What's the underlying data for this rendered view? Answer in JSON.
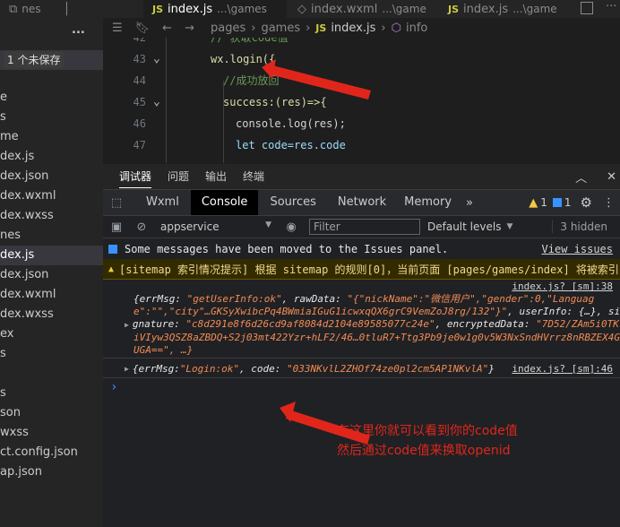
{
  "tabs": [
    {
      "name": "nes",
      "js": false,
      "path": ""
    },
    {
      "name": "index.js",
      "js": true,
      "path": "...\\games",
      "active": true
    },
    {
      "name": "index.wxml",
      "js": false,
      "path": "...\\game"
    },
    {
      "name": "index.js",
      "js": true,
      "path": "...\\game"
    }
  ],
  "tab_js_label": "JS",
  "explorer": {
    "more": "...",
    "unsaved": "1 个未保存",
    "items": [
      "e",
      "s",
      "me",
      "dex.js",
      "dex.json",
      "dex.wxml",
      "dex.wxss",
      "nes",
      "dex.js",
      "dex.json",
      "dex.wxml",
      "dex.wxss",
      "ex",
      "s",
      "",
      "s",
      "son",
      "wxss",
      "ct.config.json",
      "ap.json"
    ],
    "selected_index": 8
  },
  "breadcrumb": {
    "items": [
      "pages",
      "games",
      "index.js",
      "info"
    ],
    "js_label": "JS"
  },
  "code": {
    "lines": [
      {
        "no": "42",
        "text": "// 获取code值"
      },
      {
        "no": "43",
        "text": "wx.login({"
      },
      {
        "no": "44",
        "text": "//成功放回"
      },
      {
        "no": "45",
        "text": "success:(res)=>{"
      },
      {
        "no": "46",
        "text": "console.log(res);"
      },
      {
        "no": "47",
        "text": "let code=res.code"
      }
    ]
  },
  "devtools": {
    "top_tabs": [
      "调试器",
      "问题",
      "输出",
      "终端"
    ],
    "panel_tabs": [
      "Wxml",
      "Console",
      "Sources",
      "Network",
      "Memory"
    ],
    "more": "»",
    "warn_count": "1",
    "info_count": "1",
    "context": "appservice",
    "filter_placeholder": "Filter",
    "levels": "Default levels",
    "hidden": "3 hidden"
  },
  "console": {
    "info_msg": "Some messages have been moved to the Issues panel.",
    "info_link": "View issues",
    "warn_msg": "[sitemap 索引情况提示] 根据 sitemap 的规则[0]，当前页面 [pages/games/index] 将被索引",
    "log1_src": "index.js? [sm]:38",
    "log1_l1a": "{errMsg: ",
    "log1_l1b": "\"getUserInfo:ok\"",
    "log1_l1c": ", rawData: ",
    "log1_l1d": "\"{\"nickName\":\"微信用户\",\"gender\":0,\"Languag",
    "log1_l2a": "e\":\"\",\"city\"…GKSyXwibcPq4BWmiaIGuG1icwxqQX6grC9VemZoJ8rg/132\"}\"",
    "log1_l2b": ", userInfo: {…}, si",
    "log1_l3a": "gnature: ",
    "log1_l3b": "\"c8d291e8f6d26cd9af8084d2104e89585077c24e\"",
    "log1_l3c": ", encryptedData: ",
    "log1_l3d": "\"7D52/ZAm5i0TK",
    "log1_l4": "iVIyw3QSZ8aZBDQ+S2j03mt422Yzr+hLF2/46…0tluR7+Ttg3Pb9je0w1g0v5W3NxSndHVrrz8nRBZEX4G",
    "log1_l5": "UGA==\", …}",
    "log2_a": "{errMsg: ",
    "log2_b": "\"Login:ok\"",
    "log2_c": ", code: ",
    "log2_d": "\"033NKvlL2ZHOf74ze0pl2cm5AP1NKvlA\"",
    "log2_e": "}",
    "log2_src": "index.js? [sm]:46",
    "prompt": "›"
  },
  "annotation": {
    "line1": "在这里你就可以看到你的code值",
    "line2": "然后通过code值来换取openid",
    "color": "#e0261b"
  },
  "colors": {
    "accent": "#0e639c",
    "warn": "#f2c744",
    "info": "#3794ff",
    "error_arrow": "#e02b20"
  }
}
